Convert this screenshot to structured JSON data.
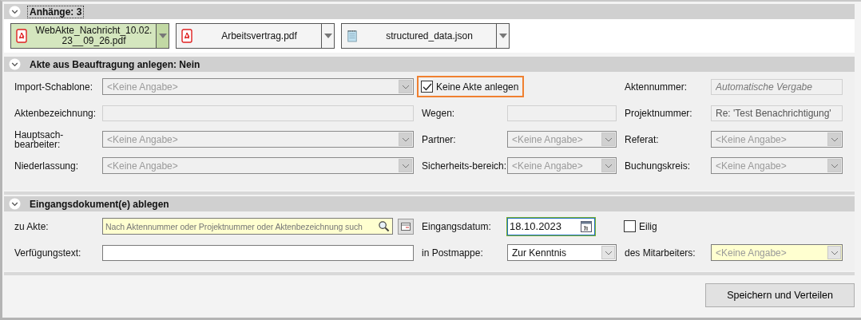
{
  "attachments_section": {
    "title": "Anhänge: 3",
    "expanded": true,
    "focused": true,
    "attachments": [
      {
        "kind": "pdf",
        "name": "WebAkte_Nachricht_10.02.23__09_26.pdf",
        "selected": true
      },
      {
        "kind": "pdf",
        "name": "Arbeitsvertrag.pdf",
        "selected": false
      },
      {
        "kind": "json",
        "name": "structured_data.json",
        "selected": false
      }
    ]
  },
  "akte_section": {
    "title": "Akte aus Beauftragung anlegen: Nein",
    "expanded": true,
    "focused": false,
    "rows": [
      [
        {
          "kind": "label",
          "text": "Import-Schablone:"
        },
        {
          "kind": "combo",
          "placeholder": "<Keine Angabe>",
          "disabled": true,
          "required": false
        },
        {
          "kind": "checkbox",
          "text": "Keine Akte anlegen",
          "checked": true,
          "focused": true
        },
        "",
        {
          "kind": "label",
          "text": "Aktennummer:"
        },
        {
          "kind": "text",
          "placeholder": "Automatische Vergabe",
          "disabled": true
        }
      ],
      [
        {
          "kind": "label",
          "text": "Aktenbezeichnung:"
        },
        {
          "kind": "text",
          "disabled": true
        },
        {
          "kind": "label",
          "text": "Wegen:"
        },
        {
          "kind": "text",
          "disabled": true
        },
        {
          "kind": "label",
          "text": "Projektnummer:"
        },
        {
          "kind": "text",
          "value": "Re: 'Test Benachrichtigung'",
          "disabled": true
        }
      ],
      [
        {
          "kind": "label",
          "text": "Hauptsach-bearbeiter:"
        },
        {
          "kind": "combo",
          "placeholder": "<Keine Angabe>",
          "disabled": true,
          "required": false
        },
        {
          "kind": "label",
          "text": "Partner:"
        },
        {
          "kind": "combo",
          "placeholder": "<Keine Angabe>",
          "disabled": true,
          "required": false
        },
        {
          "kind": "label",
          "text": "Referat:"
        },
        {
          "kind": "combo",
          "placeholder": "<Keine Angabe>",
          "disabled": true,
          "required": false
        }
      ],
      [
        {
          "kind": "label",
          "text": "Niederlassung:"
        },
        {
          "kind": "combo",
          "placeholder": "<Keine Angabe>",
          "disabled": true,
          "required": false
        },
        {
          "kind": "label",
          "text": "Sicherheits-bereich:"
        },
        {
          "kind": "combo",
          "placeholder": "<Keine Angabe>",
          "disabled": true,
          "required": false
        },
        {
          "kind": "label",
          "text": "Buchungskreis:"
        },
        {
          "kind": "combo",
          "placeholder": "<Keine Angabe>",
          "disabled": true,
          "required": false
        }
      ]
    ]
  },
  "eingang_section": {
    "title": "Eingangsdokument(e) ablegen",
    "expanded": true,
    "focused": false,
    "rows": [
      [
        {
          "kind": "label",
          "text": "zu Akte:"
        },
        {
          "kind": "search",
          "placeholder": "Nach Aktennummer oder Projektnummer oder Aktenbezeichnung such"
        },
        {
          "kind": "label",
          "text": "Eingangsdatum:"
        },
        {
          "kind": "date",
          "value": "18.10.2023",
          "focused": true
        },
        {
          "kind": "checkbox",
          "text": "Eilig",
          "checked": false,
          "focused": false
        },
        ""
      ],
      [
        {
          "kind": "label",
          "text": "Verfügungstext:"
        },
        {
          "kind": "text",
          "disabled": false
        },
        {
          "kind": "label",
          "text": "in Postmappe:"
        },
        {
          "kind": "combo",
          "value": "Zur Kenntnis",
          "disabled": false,
          "required": false
        },
        {
          "kind": "label",
          "text": "des Mitarbeiters:"
        },
        {
          "kind": "combo",
          "placeholder": "<Keine Angabe>",
          "disabled": false,
          "required": true
        }
      ]
    ]
  },
  "save_button": "Speichern und Verteilen"
}
